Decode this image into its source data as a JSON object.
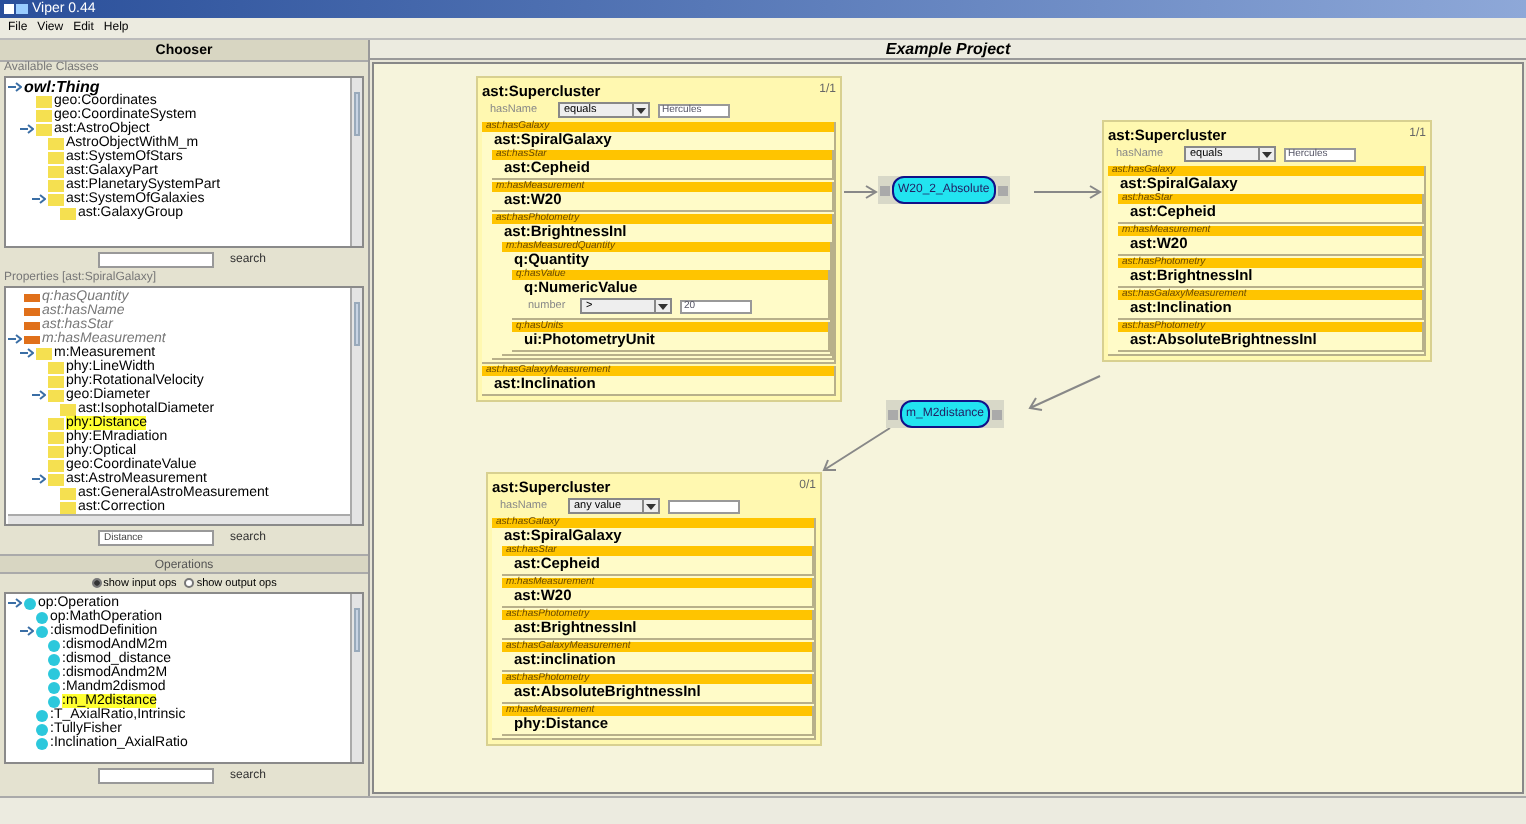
{
  "window": {
    "title": "Viper 0.44"
  },
  "menu": [
    "File",
    "View",
    "Edit",
    "Help"
  ],
  "chooser": {
    "title": "Chooser",
    "classes": {
      "label": "Available Classes",
      "search_button": "search",
      "items": [
        {
          "label": "owl:Thing",
          "kind": "root",
          "selected": false,
          "children": [
            {
              "label": "geo:Coordinates",
              "kind": "class",
              "selected": false
            },
            {
              "label": "geo:CoordinateSystem",
              "kind": "class",
              "selected": false
            },
            {
              "label": "ast:AstroObject",
              "kind": "class",
              "selected": false,
              "children": [
                {
                  "label": "AstroObjectWithM_m",
                  "kind": "class",
                  "selected": false
                },
                {
                  "label": "ast:SystemOfStars",
                  "kind": "class",
                  "selected": false
                },
                {
                  "label": "ast:GalaxyPart",
                  "kind": "class",
                  "selected": false
                },
                {
                  "label": "ast:PlanetarySystemPart",
                  "kind": "class",
                  "selected": false
                },
                {
                  "label": "ast:SystemOfGalaxies",
                  "kind": "class",
                  "selected": false,
                  "children": [
                    {
                      "label": "ast:GalaxyGroup",
                      "kind": "class",
                      "selected": false
                    }
                  ]
                }
              ]
            }
          ]
        }
      ]
    },
    "properties": {
      "label": "Properties [ast:SpiralGalaxy]",
      "search_value": "Distance",
      "search_button": "search",
      "items": [
        {
          "label": "q:hasQuantity",
          "kind": "property",
          "selected": false
        },
        {
          "label": "ast:hasName",
          "kind": "property",
          "selected": false
        },
        {
          "label": "ast:hasStar",
          "kind": "property",
          "selected": false
        },
        {
          "label": "m:hasMeasurement",
          "kind": "property",
          "selected": false,
          "children": [
            {
              "label": "m:Measurement",
              "kind": "class",
              "selected": false,
              "children": [
                {
                  "label": "phy:LineWidth",
                  "kind": "class",
                  "selected": false
                },
                {
                  "label": "phy:RotationalVelocity",
                  "kind": "class",
                  "selected": false
                },
                {
                  "label": "geo:Diameter",
                  "kind": "class",
                  "selected": false,
                  "children": [
                    {
                      "label": "ast:IsophotalDiameter",
                      "kind": "class",
                      "selected": false
                    }
                  ]
                },
                {
                  "label": "phy:Distance",
                  "kind": "class",
                  "selected": true
                },
                {
                  "label": "phy:EMradiation",
                  "kind": "class",
                  "selected": false
                },
                {
                  "label": "phy:Optical",
                  "kind": "class",
                  "selected": false
                },
                {
                  "label": "geo:CoordinateValue",
                  "kind": "class",
                  "selected": false
                },
                {
                  "label": "ast:AstroMeasurement",
                  "kind": "class",
                  "selected": false,
                  "children": [
                    {
                      "label": "ast:GeneralAstroMeasurement",
                      "kind": "class",
                      "selected": false
                    },
                    {
                      "label": "ast:Correction",
                      "kind": "class",
                      "selected": false
                    }
                  ]
                }
              ]
            }
          ]
        }
      ]
    },
    "operations": {
      "title": "Operations",
      "search_button": "search",
      "radios": [
        {
          "label": "show input ops",
          "selected": true
        },
        {
          "label": "show output ops",
          "selected": false
        }
      ],
      "items": [
        {
          "label": "op:Operation",
          "kind": "operation",
          "selected": false,
          "children": [
            {
              "label": "op:MathOperation",
              "kind": "operation",
              "selected": false
            },
            {
              "label": ":dismodDefinition",
              "kind": "operation",
              "selected": false,
              "children": [
                {
                  "label": ":dismodAndM2m",
                  "kind": "operation",
                  "selected": false
                },
                {
                  "label": ":dismod_distance",
                  "kind": "operation",
                  "selected": false
                },
                {
                  "label": ":dismodAndm2M",
                  "kind": "operation",
                  "selected": false
                },
                {
                  "label": ":Mandm2dismod",
                  "kind": "operation",
                  "selected": false
                },
                {
                  "label": ":m_M2distance",
                  "kind": "operation",
                  "selected": true
                }
              ]
            },
            {
              "label": ":T_AxialRatio,Intrinsic",
              "kind": "operation",
              "selected": false
            },
            {
              "label": ":TullyFisher",
              "kind": "operation",
              "selected": false
            },
            {
              "label": ":Inclination_AxialRatio",
              "kind": "operation",
              "selected": false
            }
          ]
        }
      ]
    }
  },
  "canvas": {
    "title": "Example Project",
    "cards": [
      {
        "title": "ast:Supercluster",
        "count": "1/1",
        "filter": {
          "label": "hasName",
          "operator": "equals",
          "value": "Hercules"
        },
        "sections": [
          {
            "property": "ast:hasGalaxy",
            "value": "ast:SpiralGalaxy",
            "children": [
              {
                "property": "ast:hasStar",
                "value": "ast:Cepheid"
              },
              {
                "property": "m:hasMeasurement",
                "value": "ast:W20"
              },
              {
                "property": "ast:hasPhotometry",
                "value": "ast:BrightnessInl",
                "children": [
                  {
                    "property": "m:hasMeasuredQuantity",
                    "value": "q:Quantity",
                    "children": [
                      {
                        "property": "q:hasValue",
                        "value": "q:NumericValue",
                        "filter": {
                          "label": "number",
                          "operator": ">",
                          "value": "20"
                        }
                      },
                      {
                        "property": "q:hasUnits",
                        "value": "ui:PhotometryUnit"
                      }
                    ]
                  }
                ]
              }
            ]
          },
          {
            "property": "ast:hasGalaxyMeasurement",
            "value": "ast:Inclination"
          }
        ]
      },
      {
        "title": "ast:Supercluster",
        "count": "1/1",
        "filter": {
          "label": "hasName",
          "operator": "equals",
          "value": "Hercules"
        },
        "sections": [
          {
            "property": "ast:hasGalaxy",
            "value": "ast:SpiralGalaxy",
            "children": [
              {
                "property": "ast:hasStar",
                "value": "ast:Cepheid"
              },
              {
                "property": "m:hasMeasurement",
                "value": "ast:W20"
              },
              {
                "property": "ast:hasPhotometry",
                "value": "ast:BrightnessInl"
              },
              {
                "property": "ast:hasGalaxyMeasurement",
                "value": "ast:Inclination"
              },
              {
                "property": "ast:hasPhotometry",
                "value": "ast:AbsoluteBrightnessInl"
              }
            ]
          }
        ]
      },
      {
        "title": "ast:Supercluster",
        "count": "0/1",
        "filter": {
          "label": "hasName",
          "operator": "any value"
        },
        "sections": [
          {
            "property": "ast:hasGalaxy",
            "value": "ast:SpiralGalaxy",
            "children": [
              {
                "property": "ast:hasStar",
                "value": "ast:Cepheid"
              },
              {
                "property": "m:hasMeasurement",
                "value": "ast:W20"
              },
              {
                "property": "ast:hasPhotometry",
                "value": "ast:BrightnessInl"
              },
              {
                "property": "ast:hasGalaxyMeasurement",
                "value": "ast:inclination"
              },
              {
                "property": "ast:hasPhotometry",
                "value": "ast:AbsoluteBrightnessInl"
              },
              {
                "property": "m:hasMeasurement",
                "value": "phy:Distance"
              }
            ]
          }
        ]
      }
    ],
    "nodes": [
      {
        "label": "W20_2_Absolute"
      },
      {
        "label": "m_M2distance"
      }
    ]
  }
}
